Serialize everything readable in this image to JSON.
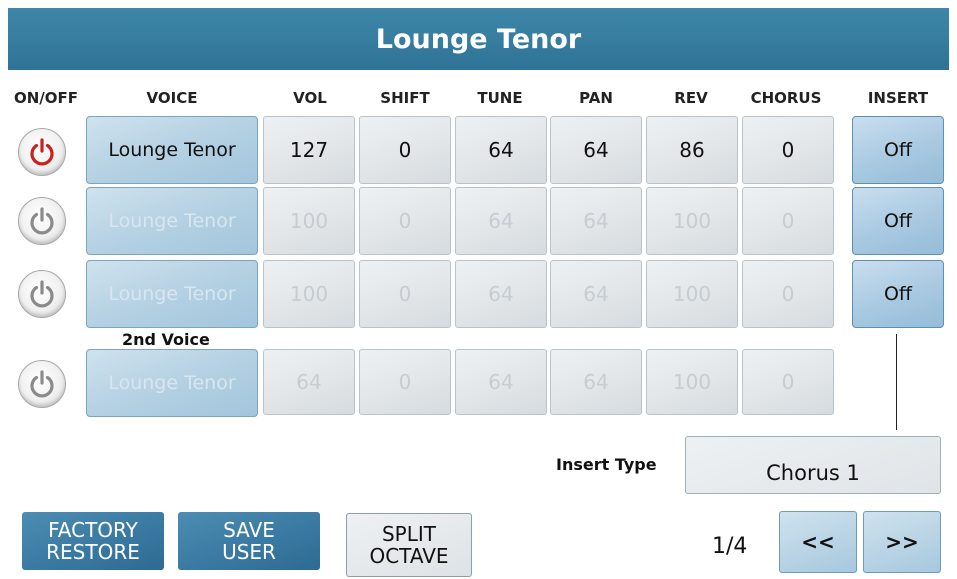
{
  "title": "Lounge Tenor",
  "columns": [
    "ON/OFF",
    "VOICE",
    "VOL",
    "SHIFT",
    "TUNE",
    "PAN",
    "REV",
    "CHORUS",
    "INSERT"
  ],
  "rows": [
    {
      "voice": "Lounge Tenor",
      "vol": "127",
      "shift": "0",
      "tune": "64",
      "pan": "64",
      "rev": "86",
      "chorus": "0",
      "insert": "Off",
      "on": true
    },
    {
      "voice": "Lounge Tenor",
      "vol": "100",
      "shift": "0",
      "tune": "64",
      "pan": "64",
      "rev": "100",
      "chorus": "0",
      "insert": "Off",
      "on": false
    },
    {
      "voice": "Lounge Tenor",
      "vol": "100",
      "shift": "0",
      "tune": "64",
      "pan": "64",
      "rev": "100",
      "chorus": "0",
      "insert": "Off",
      "on": false
    },
    {
      "voice": "Lounge Tenor",
      "vol": "64",
      "shift": "0",
      "tune": "64",
      "pan": "64",
      "rev": "100",
      "chorus": "0",
      "on": false
    }
  ],
  "second_voice_label": "2nd Voice",
  "insert_type": {
    "label": "Insert Type",
    "value": "Chorus 1"
  },
  "buttons": {
    "factory_restore": [
      "FACTORY",
      "RESTORE"
    ],
    "save_user": [
      "SAVE",
      "USER"
    ],
    "split_octave": [
      "SPLIT",
      "OCTAVE"
    ],
    "prev": "<<",
    "next": ">>"
  },
  "page_indicator": "1/4",
  "colors": {
    "title_bar": "#3a7fa3",
    "power_on": "#cc1f1f",
    "power_off": "#8a8a8a"
  }
}
